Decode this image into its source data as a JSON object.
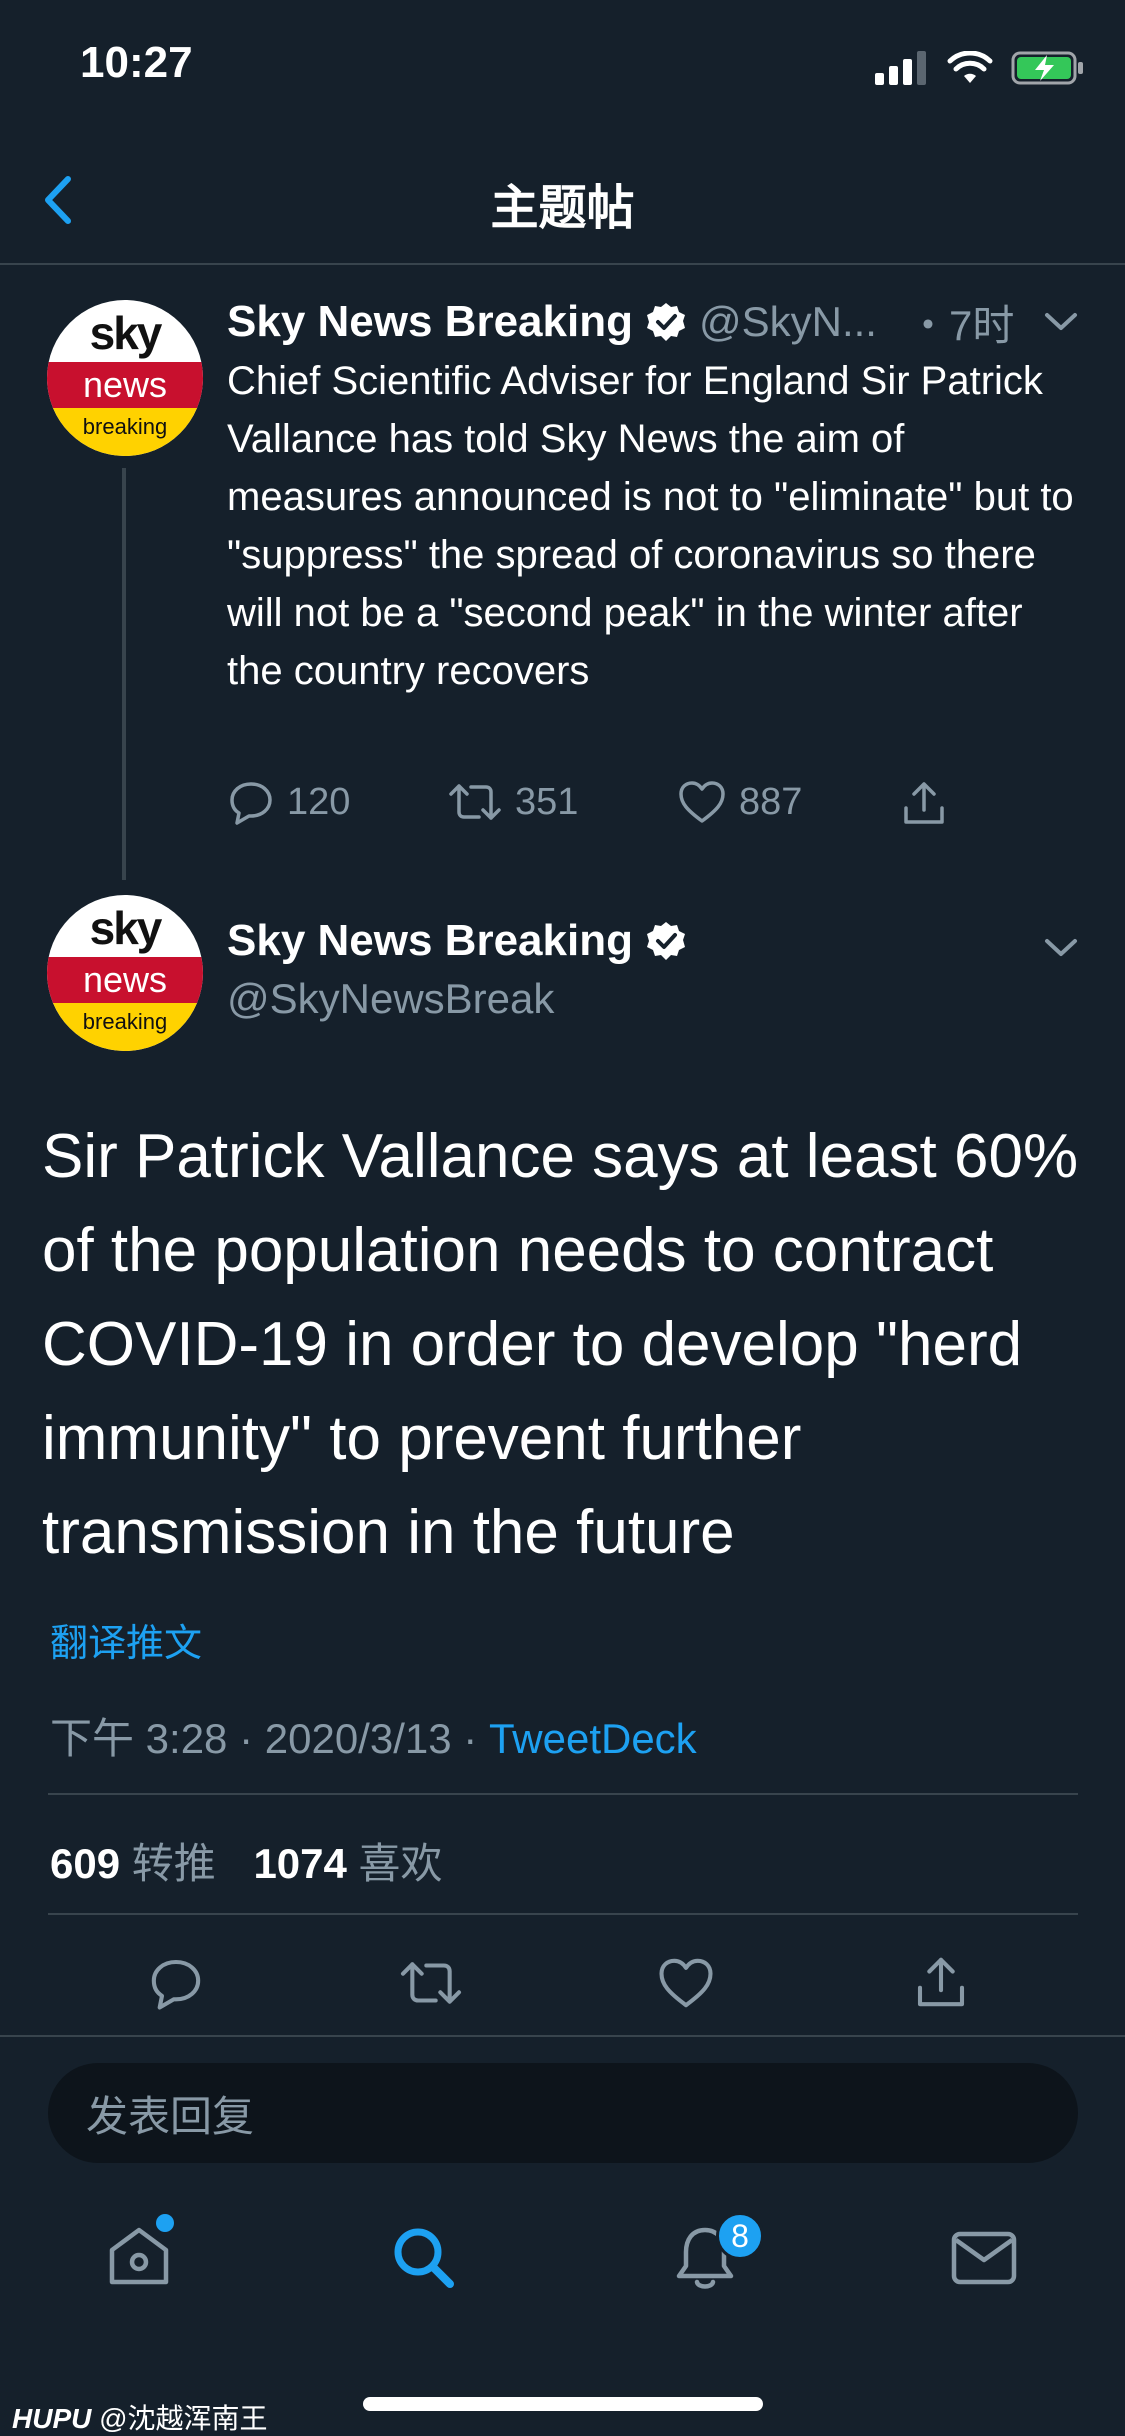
{
  "status_bar": {
    "time": "10:27"
  },
  "nav": {
    "title": "主题帖"
  },
  "tweet_parent": {
    "display_name": "Sky News Breaking",
    "handle": "@SkyN...",
    "time_ago": "・7时",
    "body": "Chief Scientific Adviser for England Sir Patrick Vallance has told Sky News the aim of measures announced is not to \"eliminate\" but to \"suppress\" the spread of coronavirus so there will not be a \"second peak\" in the winter after the country recovers",
    "replies": "120",
    "retweets": "351",
    "likes": "887"
  },
  "avatar": {
    "line1": "sky",
    "line2": "news",
    "line3": "breaking"
  },
  "tweet_main": {
    "display_name": "Sky News Breaking",
    "handle": "@SkyNewsBreak",
    "body": "Sir Patrick Vallance says at least 60% of the population needs to contract COVID-19 in order to develop \"herd immunity\" to prevent further transmission in the future",
    "translate": "翻译推文",
    "time": "下午 3:28",
    "date": "2020/3/13",
    "source": "TweetDeck",
    "retweet_count": "609",
    "retweet_label": "转推",
    "like_count": "1074",
    "like_label": "喜欢"
  },
  "reply": {
    "placeholder": "发表回复"
  },
  "tabbar": {
    "notifications_badge": "8"
  },
  "watermark": {
    "brand": "HUPU",
    "user": "@沈越浑南王"
  },
  "colors": {
    "background": "#15202b",
    "accent": "#1da1f2",
    "muted": "#8899a6",
    "divider": "#38444d"
  }
}
